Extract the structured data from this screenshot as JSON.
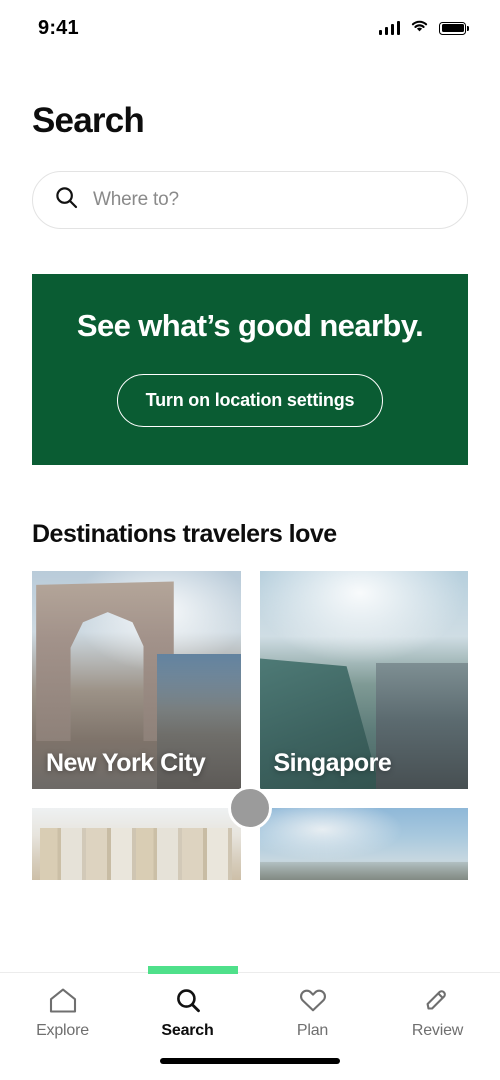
{
  "status_bar": {
    "time": "9:41",
    "cellular_icon": "cellular-signal-icon",
    "wifi_icon": "wifi-icon",
    "battery_icon": "battery-full-icon"
  },
  "header": {
    "title": "Search"
  },
  "search": {
    "icon": "search-icon",
    "value": "",
    "placeholder": "Where to?"
  },
  "promo_banner": {
    "title": "See what’s good nearby.",
    "button_label": "Turn on location settings",
    "background_color": "#0a5c33",
    "text_color": "#ffffff"
  },
  "destinations": {
    "section_title": "Destinations travelers love",
    "cards": [
      {
        "label": "New York City",
        "photo": "washington-square-arch-photo"
      },
      {
        "label": "Singapore",
        "photo": "marina-bay-infinity-pool-photo"
      },
      {
        "label": "",
        "photo": "rome-buildings-photo"
      },
      {
        "label": "",
        "photo": "city-skyline-photo"
      }
    ]
  },
  "overlay": {
    "drag_handle": "drag-handle-cursor",
    "selection_strip_color": "#4fe08a"
  },
  "tabbar": {
    "items": [
      {
        "label": "Explore",
        "icon": "home-icon",
        "active": false
      },
      {
        "label": "Search",
        "icon": "search-icon",
        "active": true
      },
      {
        "label": "Plan",
        "icon": "heart-icon",
        "active": false
      },
      {
        "label": "Review",
        "icon": "pencil-icon",
        "active": false
      }
    ]
  },
  "home_indicator": "home-indicator-bar"
}
